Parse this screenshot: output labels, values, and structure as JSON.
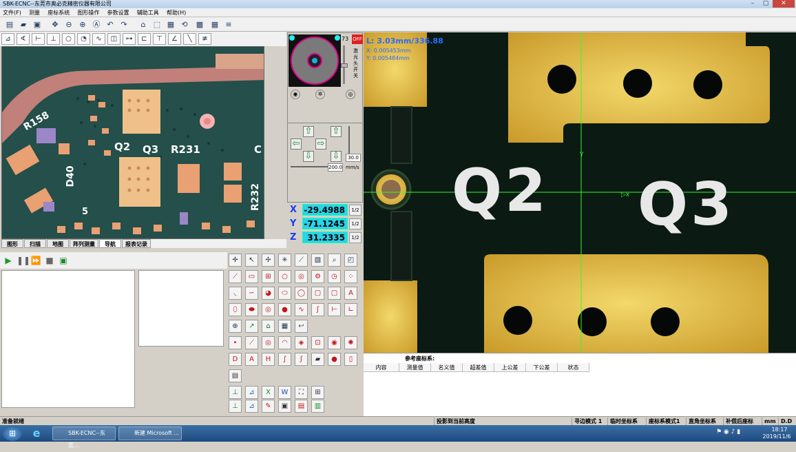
{
  "window": {
    "title": "SBK-ECNC--东莞市奥必克精密仪器有限公司"
  },
  "menu": [
    "文件(F)",
    "测量",
    "座标系统",
    "图形操作",
    "参数设置",
    "辅助工具",
    "帮助(H)"
  ],
  "camera_tabs": [
    "图形",
    "扫描",
    "地图",
    "阵列测量",
    "导航",
    "报表记录"
  ],
  "camera_silkscreen": [
    "R158",
    "Q2",
    "Q3",
    "R231",
    "D40",
    "R232",
    "C",
    "5"
  ],
  "reticle": {
    "channel": "73",
    "status_button": "OFF",
    "light_label": "激光头开关"
  },
  "jog": {
    "step_value": "30.0",
    "speed_value": "200.0",
    "speed_unit": "mm/s"
  },
  "dro": {
    "x_label": "X",
    "x_value": "-29.4988",
    "y_label": "Y",
    "y_value": "-71.1245",
    "z_label": "Z",
    "z_value": "31.2335",
    "half_label": "1/2"
  },
  "overlay": {
    "line1": "L: 3.03mm/336.88",
    "line2": "X: 0.005453mm",
    "line3": "Y: 0.005484mm"
  },
  "main_silkscreen": {
    "q2": "Q2",
    "q3": "Q3"
  },
  "results": {
    "title": "参考座标系:",
    "columns": [
      "内容",
      "测量值",
      "名义值",
      "超差值",
      "上公差",
      "下公差",
      "状态"
    ]
  },
  "status": {
    "ready": "准备就绪",
    "height_btn": "投影到当前高度",
    "edge_mode": "寻边模式 1",
    "temp_coord": "临时坐标系",
    "coord_mode": "座标系模式1",
    "rect_coord": "直角坐标系",
    "comp_coord": "补偿后座标",
    "unit": "mm",
    "dd": "D.D"
  },
  "taskbar": {
    "task1": "SBK-ECNC--东莞...",
    "task2": "新建 Microsoft ...",
    "time": "18:17",
    "date": "2019/11/6"
  },
  "colors": {
    "accent": "#1a3aff",
    "dro_bg": "#29d3ea",
    "crosshair": "#2cff2c",
    "gold": "#e7c24a"
  }
}
